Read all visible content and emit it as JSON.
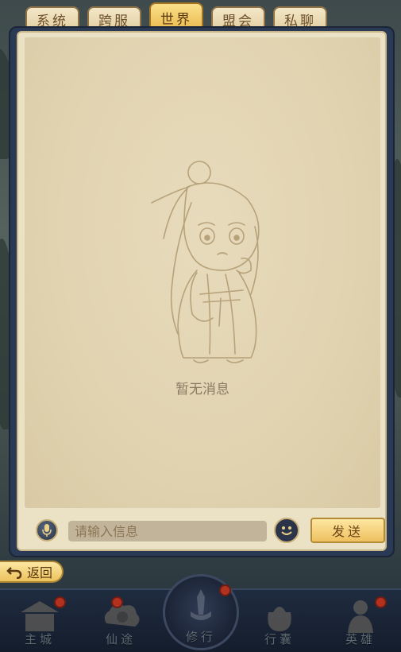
{
  "tabs": [
    {
      "label": "系统",
      "active": false
    },
    {
      "label": "跨服",
      "active": false
    },
    {
      "label": "世界",
      "active": true
    },
    {
      "label": "盟会",
      "active": false
    },
    {
      "label": "私聊",
      "active": false
    }
  ],
  "chat": {
    "empty_text": "暂无消息"
  },
  "input": {
    "placeholder": "请输入信息",
    "send_label": "发送"
  },
  "back_label": "返回",
  "bottom_nav": [
    {
      "label": "主城",
      "icon": "palace-icon",
      "has_dot": true
    },
    {
      "label": "仙途",
      "icon": "cloud-scroll-icon",
      "has_dot": true
    },
    {
      "label": "修行",
      "icon": "sword-icon",
      "has_dot": true
    },
    {
      "label": "行囊",
      "icon": "bag-icon",
      "has_dot": false
    },
    {
      "label": "英雄",
      "icon": "hero-icon",
      "has_dot": true
    }
  ],
  "colors": {
    "active_tab": "#eab84c",
    "panel_frame": "#2a3a55",
    "notification_dot": "#b2321f"
  }
}
